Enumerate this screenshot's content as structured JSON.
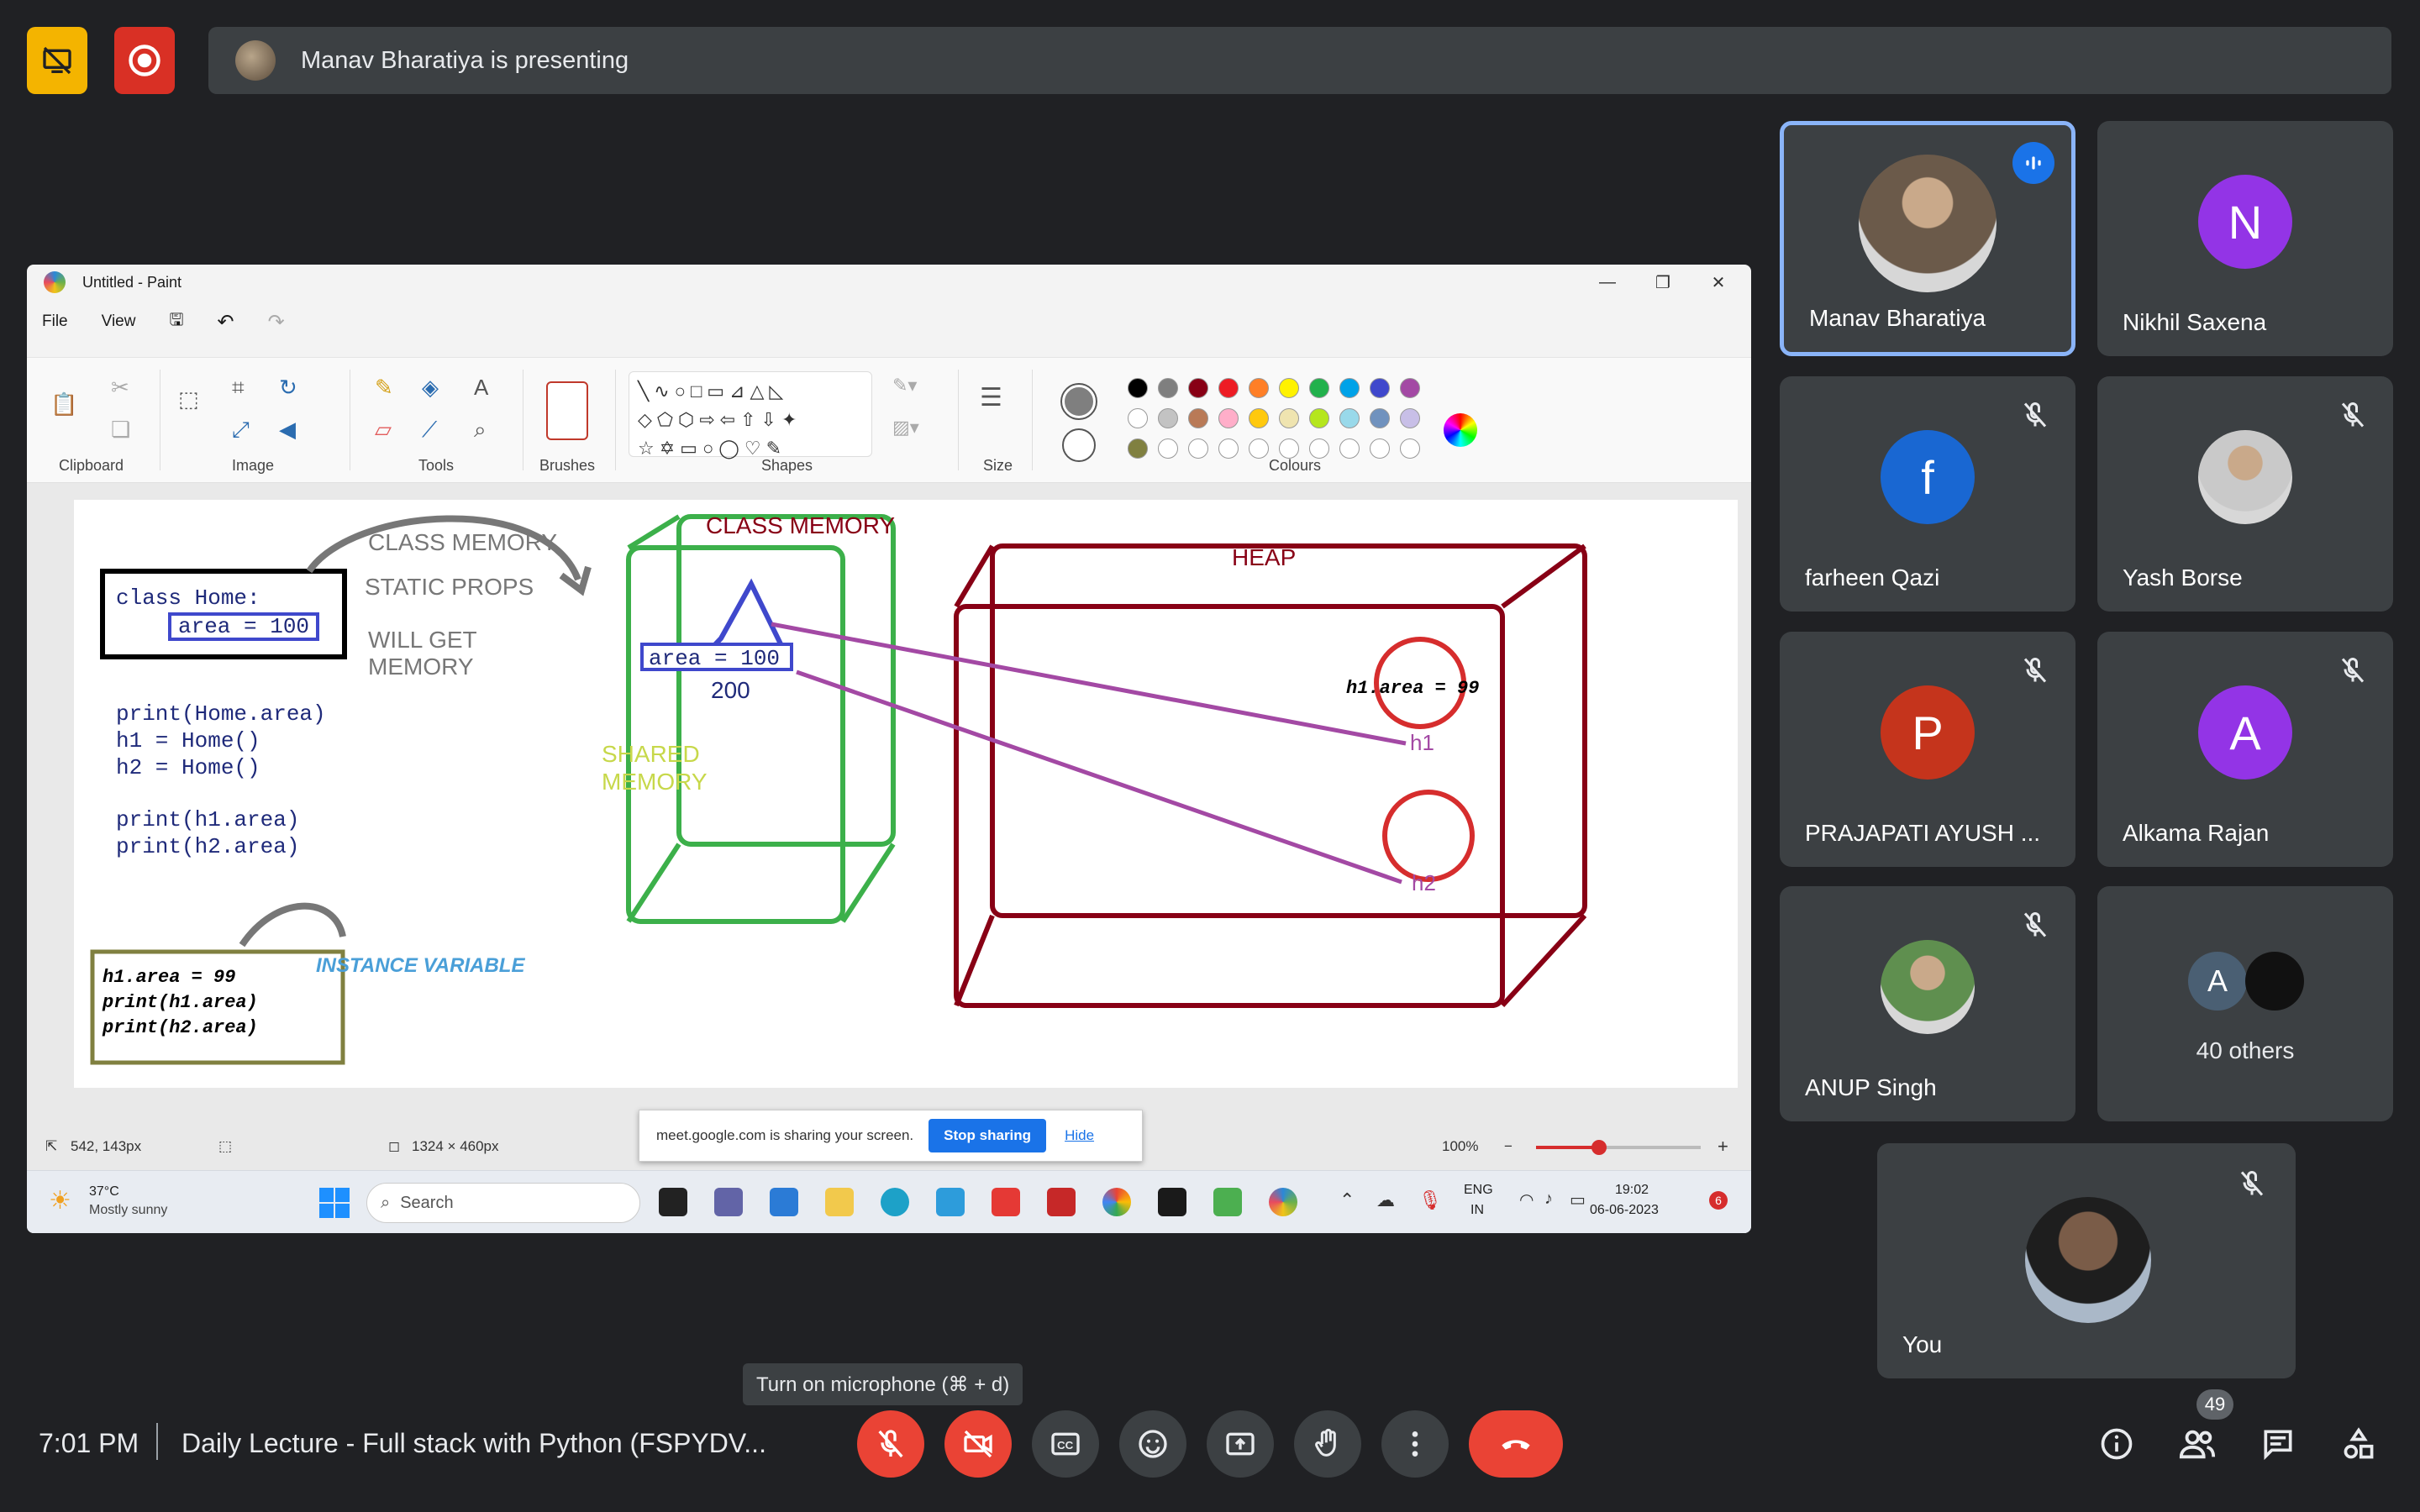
{
  "meet": {
    "presenting_text": "Manav Bharatiya is presenting",
    "time": "7:01 PM",
    "meeting_title": "Daily Lecture - Full stack with Python (FSPYDV...",
    "mic_tooltip": "Turn on microphone (⌘ + d)",
    "participant_count": "49",
    "colors": {
      "bg": "#202124",
      "tile": "#3c4043",
      "accent": "#8ab4f8",
      "danger": "#ea4335",
      "warn": "#f4b400"
    }
  },
  "participants": [
    {
      "name": "Manav Bharatiya",
      "initial": "",
      "color": "#6b5a4a",
      "muted": false,
      "speaking": true
    },
    {
      "name": "Nikhil Saxena",
      "initial": "N",
      "color": "#9334e6",
      "muted": false,
      "speaking": false
    },
    {
      "name": "farheen Qazi",
      "initial": "f",
      "color": "#1967d2",
      "muted": true,
      "speaking": false
    },
    {
      "name": "Yash Borse",
      "initial": "",
      "color": "#c9c9c9",
      "muted": true,
      "speaking": false
    },
    {
      "name": "PRAJAPATI AYUSH ...",
      "initial": "P",
      "color": "#c5341c",
      "muted": true,
      "speaking": false
    },
    {
      "name": "Alkama Rajan",
      "initial": "A",
      "color": "#9334e6",
      "muted": true,
      "speaking": false
    },
    {
      "name": "ANUP Singh",
      "initial": "",
      "color": "#5f8f4f",
      "muted": true,
      "speaking": false
    }
  ],
  "others": {
    "initial": "A",
    "label": "40 others"
  },
  "you": {
    "name": "You"
  },
  "paint": {
    "title": "Untitled - Paint",
    "menu": [
      "File",
      "View"
    ],
    "groups": [
      "Clipboard",
      "Image",
      "Tools",
      "Brushes",
      "Shapes",
      "Size",
      "Colours"
    ],
    "status_cursor": "542, 143px",
    "status_size": "1324 × 460px",
    "zoom": "100%",
    "share_banner": "meet.google.com is sharing your screen.",
    "stop_sharing": "Stop sharing",
    "hide": "Hide",
    "weather_temp": "37°C",
    "weather_desc": "Mostly sunny",
    "search": "Search",
    "lang": "ENG",
    "region": "IN",
    "clock_time": "19:02",
    "clock_date": "06-06-2023",
    "notif_count": "6",
    "palette_row1": [
      "#000000",
      "#7f7f7f",
      "#880015",
      "#ed1c24",
      "#ff7f27",
      "#fff200",
      "#22b14c",
      "#00a2e8",
      "#3f48cc",
      "#a349a4"
    ],
    "palette_row2": [
      "#ffffff",
      "#c3c3c3",
      "#b97a57",
      "#ffaec9",
      "#ffc90e",
      "#efe4b0",
      "#b5e61d",
      "#99d9ea",
      "#7092be",
      "#c8bfe7"
    ],
    "palette_row3": [
      "#808040",
      "#ffffff",
      "#ffffff",
      "#ffffff",
      "#ffffff",
      "#ffffff",
      "#ffffff",
      "#ffffff",
      "#ffffff",
      "#ffffff"
    ]
  },
  "drawing": {
    "code1": "class Home:",
    "code2": "area = 100",
    "note1": "CLASS MEMORY",
    "note2": "STATIC PROPS",
    "note3": "WILL GET",
    "note4": "MEMORY",
    "code3": "print(Home.area)",
    "code4": "h1 =  Home()",
    "code5": "h2 = Home()",
    "code6": "print(h1.area)",
    "code7": "print(h2.area)",
    "box_title": "CLASS MEMORY",
    "box_area": "area = 100",
    "box_200": "200",
    "shared1": "SHARED",
    "shared2": "MEMORY",
    "heap": "HEAP",
    "h1_area": "h1.area = 99",
    "h1": "h1",
    "h2": "h2",
    "inst1": "h1.area = 99",
    "inst2": "print(h1.area)",
    "inst3": "print(h2.area)",
    "inst_label": "INSTANCE VARIABLE"
  }
}
